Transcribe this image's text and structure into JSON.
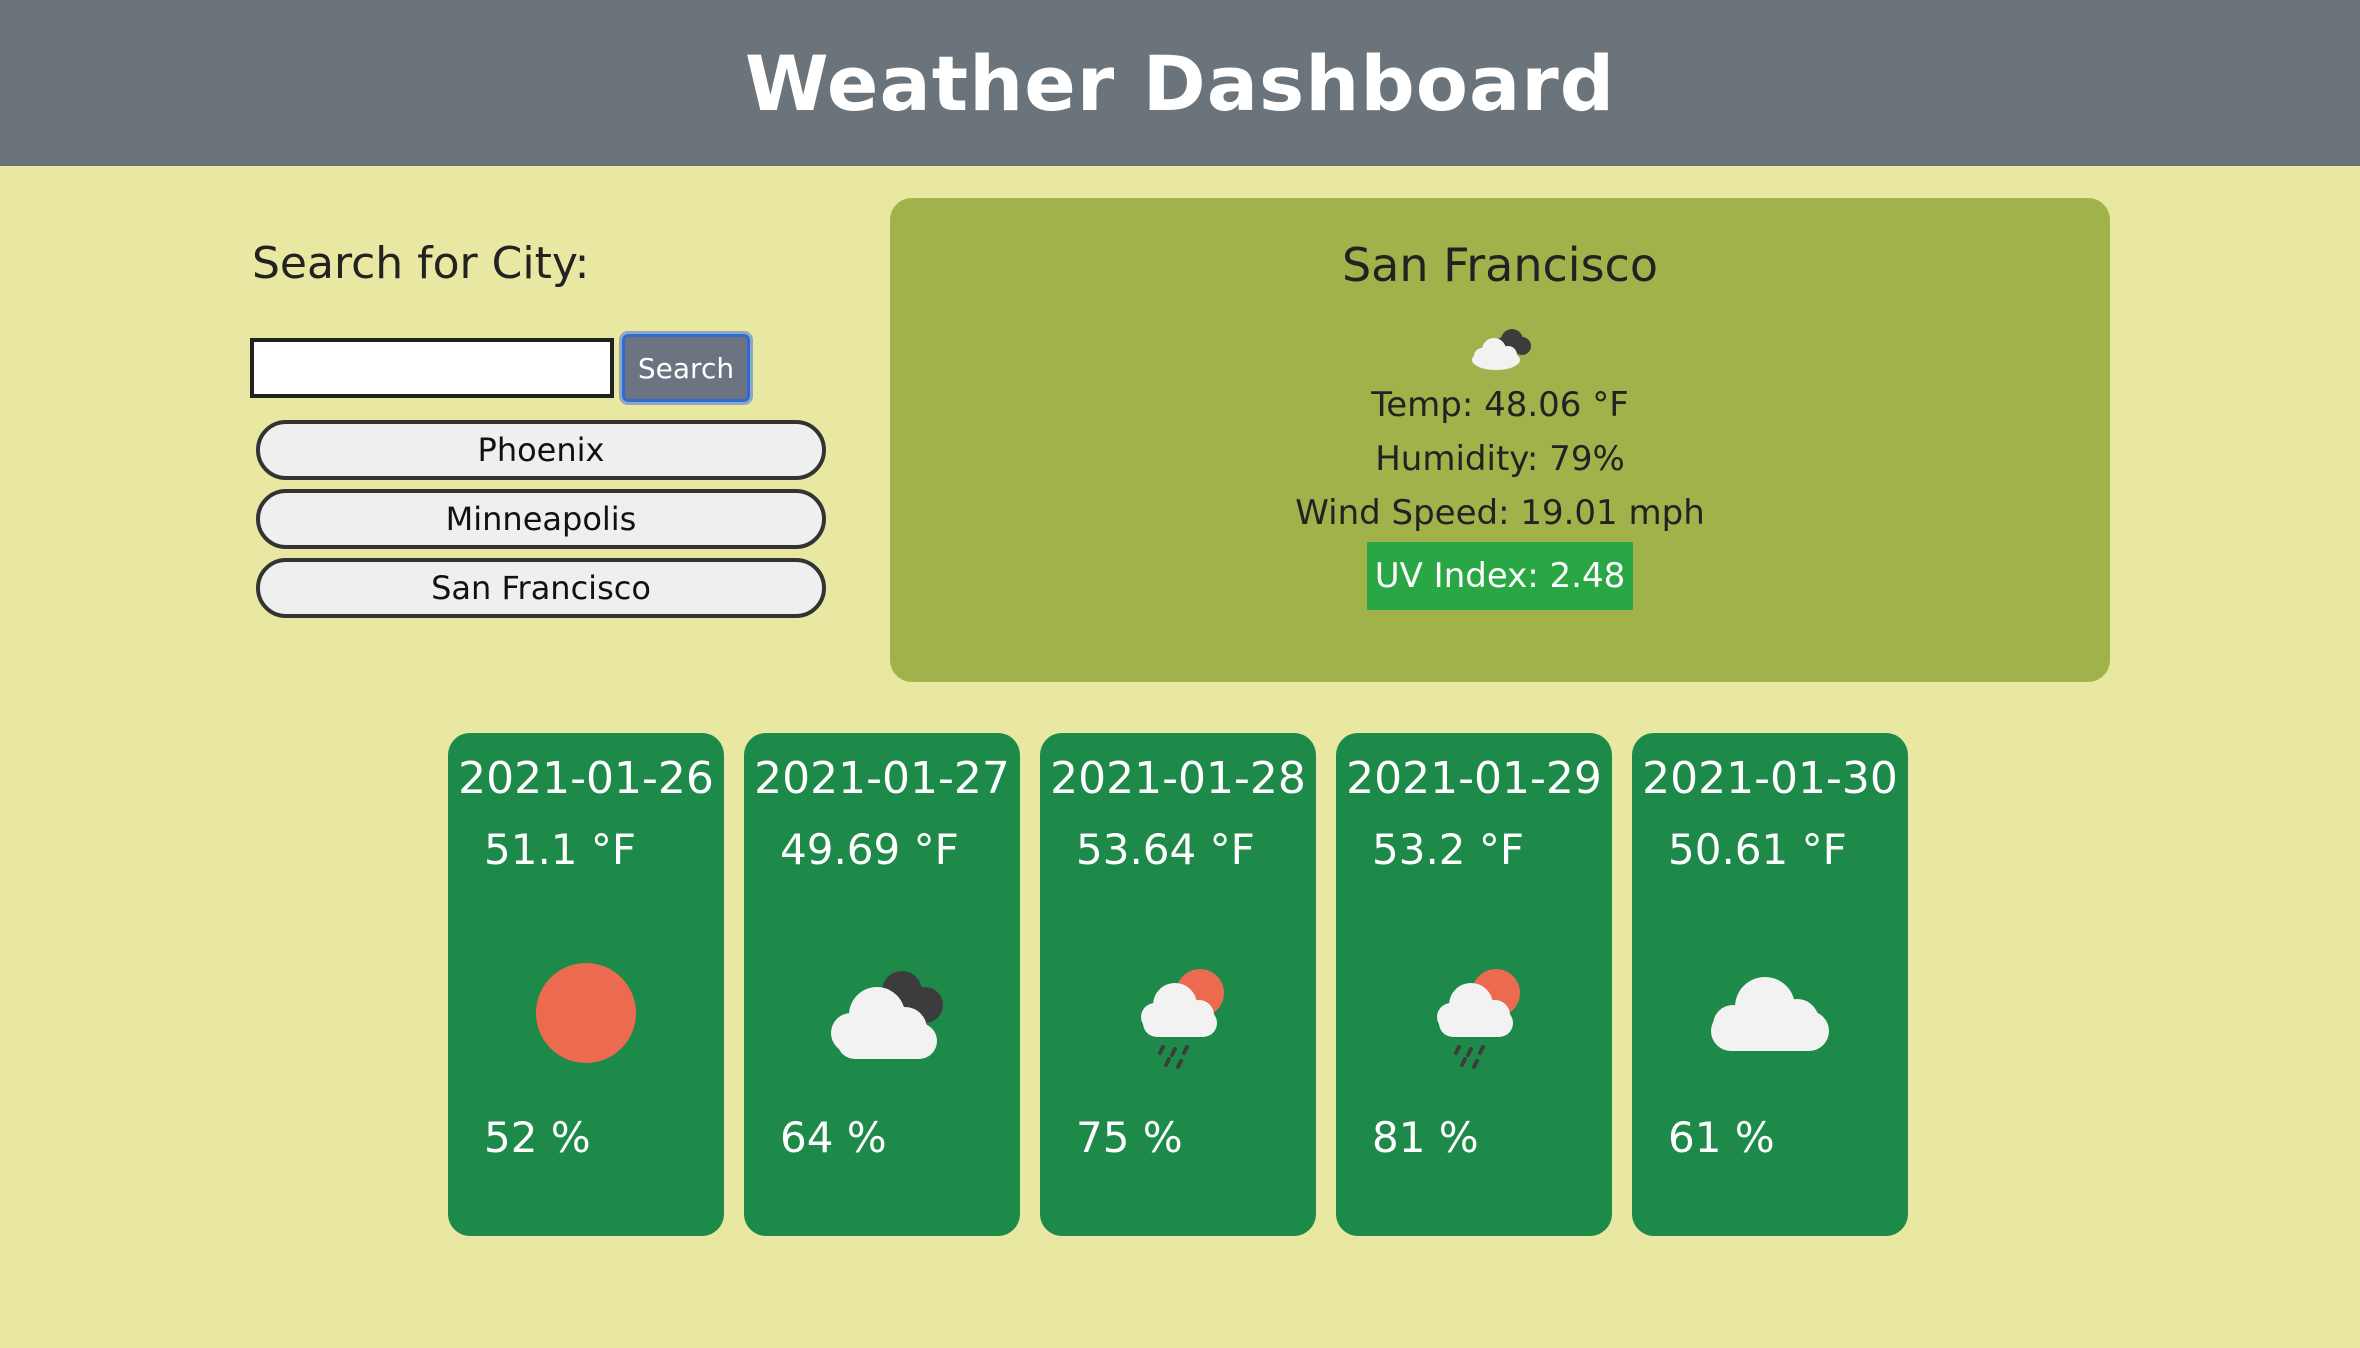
{
  "header": {
    "title": "Weather Dashboard",
    "bg_color": "#6c747b"
  },
  "search": {
    "label": "Search for City:",
    "input_value": "",
    "button_label": "Search",
    "history": [
      {
        "label": "Phoenix"
      },
      {
        "label": "Minneapolis"
      },
      {
        "label": "San Francisco"
      }
    ]
  },
  "current": {
    "city": "San Francisco",
    "icon": "partly-cloudy-night-icon",
    "temp": "Temp: 48.06 °F",
    "humidity": "Humidity: 79%",
    "wind": "Wind Speed: 19.01 mph",
    "uv": "UV Index: 2.48",
    "uv_color": "#29a745",
    "panel_color": "#a1b24a"
  },
  "forecast": [
    {
      "date": "2021-01-26",
      "temp": "51.1 °F",
      "icon": "sun-icon",
      "humidity": "52 %"
    },
    {
      "date": "2021-01-27",
      "temp": "49.69 °F",
      "icon": "broken-clouds-icon",
      "humidity": "64 %"
    },
    {
      "date": "2021-01-28",
      "temp": "53.64 °F",
      "icon": "rain-sun-icon",
      "humidity": "75 %"
    },
    {
      "date": "2021-01-29",
      "temp": "53.2 °F",
      "icon": "rain-sun-icon",
      "humidity": "81 %"
    },
    {
      "date": "2021-01-30",
      "temp": "50.61 °F",
      "icon": "cloud-icon",
      "humidity": "61 %"
    }
  ],
  "colors": {
    "page_bg": "#e8e8a2",
    "card_bg": "#1e8a4a"
  }
}
